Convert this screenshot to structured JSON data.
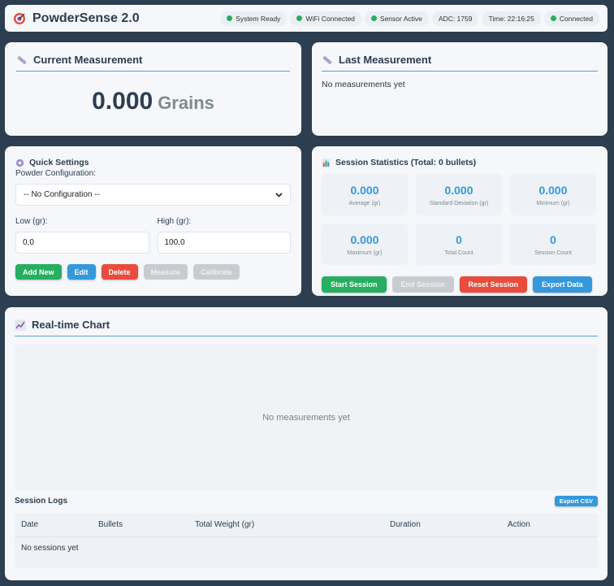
{
  "header": {
    "title": "PowderSense 2.0",
    "statuses": [
      {
        "label": "System Ready",
        "dot": true
      },
      {
        "label": "WiFi Connected",
        "dot": true
      },
      {
        "label": "Sensor Active",
        "dot": true
      },
      {
        "label": "ADC: 1759",
        "dot": false
      },
      {
        "label": "Time: 22:16:25",
        "dot": false
      },
      {
        "label": "Connected",
        "dot": true
      }
    ]
  },
  "current": {
    "title": "Current Measurement",
    "value": "0.000",
    "unit": "Grains"
  },
  "last": {
    "title": "Last Measurement",
    "empty_text": "No measurements yet"
  },
  "quick": {
    "title": "Quick Settings",
    "config_label": "Powder Configuration:",
    "config_selected": "-- No Configuration --",
    "low_label": "Low (gr):",
    "low_value": "0,0",
    "high_label": "High (gr):",
    "high_value": "100,0",
    "buttons": {
      "add_new": "Add New",
      "edit": "Edit",
      "delete": "Delete",
      "measure": "Measure",
      "calibrate": "Calibrate"
    }
  },
  "stats": {
    "title": "Session Statistics (Total: 0 bullets)",
    "items": [
      {
        "value": "0.000",
        "label": "Average (gr)"
      },
      {
        "value": "0.000",
        "label": "Standard Deviation (gr)"
      },
      {
        "value": "0.000",
        "label": "Minimum (gr)"
      },
      {
        "value": "0.000",
        "label": "Maximum (gr)"
      },
      {
        "value": "0",
        "label": "Total Count"
      },
      {
        "value": "0",
        "label": "Session Count"
      }
    ],
    "buttons": {
      "start": "Start Session",
      "end": "End Session",
      "reset": "Reset Session",
      "export": "Export Data"
    }
  },
  "chart": {
    "title": "Real-time Chart",
    "empty_text": "No measurements yet"
  },
  "logs": {
    "title": "Session Logs",
    "export_label": "Export CSV",
    "columns": [
      "Date",
      "Bullets",
      "Total Weight (gr)",
      "Duration",
      "Action"
    ],
    "empty_text": "No sessions yet"
  },
  "colors": {
    "background": "#2c3e50",
    "card": "#f5f7fa",
    "accent": "#3498db",
    "success": "#27ae60",
    "danger": "#e74c3c",
    "disabled": "#c8ccd0"
  }
}
